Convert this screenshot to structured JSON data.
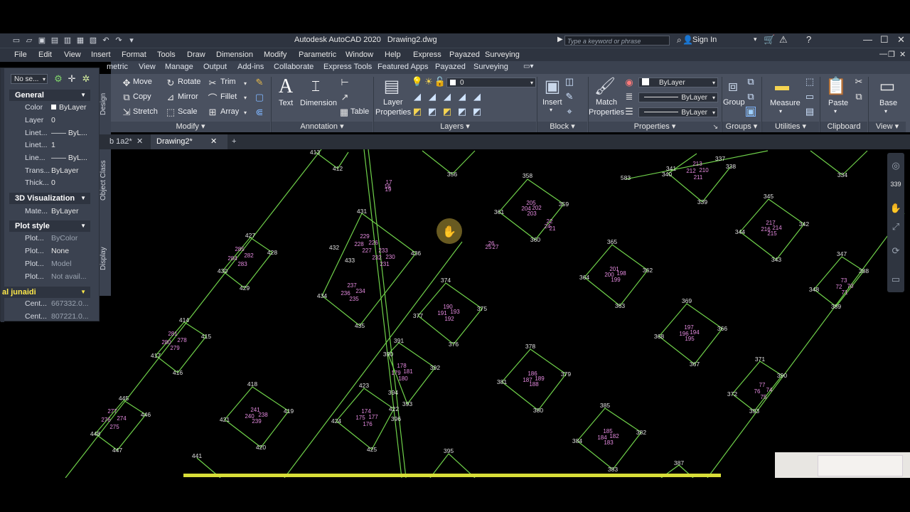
{
  "app": {
    "title": "Autodesk AutoCAD 2020   Drawing2.dwg",
    "search_placeholder": "Type a keyword or phrase",
    "sign_in": "Sign In"
  },
  "menu": [
    "File",
    "Edit",
    "View",
    "Insert",
    "Format",
    "Tools",
    "Draw",
    "Dimension",
    "Modify",
    "Parametric",
    "Window",
    "Help",
    "Express",
    "Payazed",
    "Surveying"
  ],
  "ribbon_tabs": [
    "metric",
    "View",
    "Manage",
    "Output",
    "Add-ins",
    "Collaborate",
    "Express Tools",
    "Featured Apps",
    "Payazed",
    "Surveying"
  ],
  "ribbon": {
    "modify": {
      "title": "Modify",
      "move": "Move",
      "rotate": "Rotate",
      "trim": "Trim",
      "copy": "Copy",
      "mirror": "Mirror",
      "fillet": "Fillet",
      "stretch": "Stretch",
      "scale": "Scale",
      "array": "Array"
    },
    "annotation": {
      "title": "Annotation",
      "text": "Text",
      "dimension": "Dimension",
      "table": "Table"
    },
    "layers": {
      "title": "Layers",
      "layer_properties_1": "Layer",
      "layer_properties_2": "Properties",
      "current_layer": "0"
    },
    "block": {
      "title": "Block",
      "insert": "Insert"
    },
    "properties": {
      "title": "Properties",
      "match_1": "Match",
      "match_2": "Properties",
      "color": "ByLayer",
      "linetype": "ByLayer",
      "lineweight": "ByLayer"
    },
    "groups": {
      "title": "Groups",
      "group": "Group"
    },
    "utilities": {
      "title": "Utilities",
      "measure": "Measure"
    },
    "clipboard": {
      "title": "Clipboard",
      "paste": "Paste"
    },
    "view": {
      "title": "View",
      "base": "Base"
    }
  },
  "doc_tabs": [
    {
      "label": "b 1a2*"
    },
    {
      "label": "Drawing2*"
    }
  ],
  "palette": {
    "selection": "No se...",
    "general_title": "General",
    "general": [
      {
        "k": "Color",
        "v": "ByLayer"
      },
      {
        "k": "Layer",
        "v": "0"
      },
      {
        "k": "Linet...",
        "v": "—— ByL..."
      },
      {
        "k": "Linet...",
        "v": "1"
      },
      {
        "k": "Line...",
        "v": "—— ByL..."
      },
      {
        "k": "Trans...",
        "v": "ByLayer"
      },
      {
        "k": "Thick...",
        "v": "0"
      }
    ],
    "viz_title": "3D Visualization",
    "viz": [
      {
        "k": "Mate...",
        "v": "ByLayer"
      }
    ],
    "plot_title": "Plot style",
    "plot": [
      {
        "k": "Plot...",
        "v": "ByColor"
      },
      {
        "k": "Plot...",
        "v": "None"
      },
      {
        "k": "Plot...",
        "v": "Model"
      },
      {
        "k": "Plot...",
        "v": "Not avail..."
      }
    ],
    "custom_title": "al junaidi",
    "custom": [
      {
        "k": "Cent...",
        "v": "667332.0..."
      },
      {
        "k": "Cent...",
        "v": "807221.0..."
      }
    ],
    "side_tabs": [
      "Design",
      "Object Class",
      "Display"
    ]
  },
  "drawing": {
    "line_color": "#6fd14a",
    "label_color": "#e0e0e0",
    "inner_color": "#e58be0",
    "points": [
      [
        "413",
        443,
        214
      ],
      [
        "412",
        475,
        237
      ],
      [
        "356",
        636,
        245
      ],
      [
        "358",
        742,
        247
      ],
      [
        "583",
        880,
        250
      ],
      [
        "340",
        938,
        245
      ],
      [
        "341",
        944,
        237
      ],
      [
        "337",
        1013,
        223
      ],
      [
        "338",
        1028,
        234
      ],
      [
        "339",
        988,
        284
      ],
      [
        "334",
        1185,
        246
      ],
      [
        "335",
        1260,
        260
      ],
      [
        "431",
        509,
        297
      ],
      [
        "361",
        702,
        298
      ],
      [
        "359",
        793,
        287
      ],
      [
        "345",
        1081,
        276
      ],
      [
        "344",
        1041,
        326
      ],
      [
        "342",
        1131,
        315
      ],
      [
        "343",
        1092,
        365
      ],
      [
        "427",
        352,
        331
      ],
      [
        "428",
        383,
        355
      ],
      [
        "430",
        313,
        381
      ],
      [
        "429",
        344,
        405
      ],
      [
        "432",
        470,
        348
      ],
      [
        "433",
        492,
        366
      ],
      [
        "436",
        585,
        356
      ],
      [
        "360",
        753,
        337
      ],
      [
        "365",
        861,
        340
      ],
      [
        "364",
        822,
        390
      ],
      [
        "362",
        911,
        380
      ],
      [
        "363",
        872,
        430
      ],
      [
        "347",
        1184,
        357
      ],
      [
        "388",
        1215,
        381
      ],
      [
        "348",
        1145,
        407
      ],
      [
        "389",
        1176,
        431
      ],
      [
        "374",
        627,
        394
      ],
      [
        "375",
        678,
        434
      ],
      [
        "377",
        588,
        444
      ],
      [
        "376",
        638,
        484
      ],
      [
        "434",
        453,
        416
      ],
      [
        "435",
        506,
        458
      ],
      [
        "414",
        259,
        450
      ],
      [
        "415",
        290,
        473
      ],
      [
        "417",
        219,
        500
      ],
      [
        "416",
        250,
        524
      ],
      [
        "391",
        561,
        479
      ],
      [
        "390",
        546,
        498
      ],
      [
        "392",
        612,
        517
      ],
      [
        "369",
        966,
        423
      ],
      [
        "366",
        1016,
        462
      ],
      [
        "368",
        927,
        473
      ],
      [
        "367",
        977,
        512
      ],
      [
        "378",
        746,
        487
      ],
      [
        "379",
        796,
        526
      ],
      [
        "381",
        706,
        537
      ],
      [
        "380",
        757,
        577
      ],
      [
        "371",
        1069,
        505
      ],
      [
        "390",
        1100,
        528
      ],
      [
        "372",
        1030,
        554
      ],
      [
        "393",
        1061,
        578
      ],
      [
        "418",
        355,
        540
      ],
      [
        "419",
        406,
        578
      ],
      [
        "421",
        316,
        590
      ],
      [
        "420",
        367,
        629
      ],
      [
        "423",
        512,
        542
      ],
      [
        "422",
        554,
        575
      ],
      [
        "424",
        473,
        592
      ],
      [
        "425",
        523,
        632
      ],
      [
        "394",
        553,
        552
      ],
      [
        "393",
        573,
        568
      ],
      [
        "396",
        557,
        589
      ],
      [
        "445",
        174,
        560
      ],
      [
        "446",
        205,
        583
      ],
      [
        "448",
        134,
        610
      ],
      [
        "447",
        165,
        633
      ],
      [
        "385",
        851,
        570
      ],
      [
        "382",
        902,
        608
      ],
      [
        "384",
        812,
        620
      ],
      [
        "383",
        862,
        660
      ],
      [
        "441",
        277,
        641
      ],
      [
        "395",
        631,
        634
      ],
      [
        "387",
        955,
        651
      ]
    ],
    "inner_labels": [
      [
        "17",
        547,
        256
      ],
      [
        "16",
        545,
        262
      ],
      [
        "19",
        546,
        266
      ],
      [
        "205",
        747,
        285
      ],
      [
        "204",
        740,
        293
      ],
      [
        "202",
        755,
        292
      ],
      [
        "203",
        748,
        300
      ],
      [
        "22",
        773,
        311
      ],
      [
        "24",
        770,
        318
      ],
      [
        "21",
        777,
        321
      ],
      [
        "213",
        981,
        230
      ],
      [
        "212",
        972,
        240
      ],
      [
        "210",
        990,
        239
      ],
      [
        "211",
        982,
        249
      ],
      [
        "217",
        1084,
        313
      ],
      [
        "216",
        1077,
        322
      ],
      [
        "214",
        1093,
        320
      ],
      [
        "215",
        1086,
        328
      ],
      [
        "229",
        513,
        332
      ],
      [
        "228",
        505,
        343
      ],
      [
        "226",
        525,
        341
      ],
      [
        "233",
        539,
        352
      ],
      [
        "227",
        516,
        352
      ],
      [
        "232",
        530,
        362
      ],
      [
        "230",
        549,
        361
      ],
      [
        "231",
        541,
        371
      ],
      [
        "285",
        337,
        350
      ],
      [
        "284",
        327,
        363
      ],
      [
        "282",
        350,
        359
      ],
      [
        "283",
        341,
        371
      ],
      [
        "26",
        691,
        342
      ],
      [
        "25",
        687,
        347
      ],
      [
        "27",
        697,
        347
      ],
      [
        "201",
        864,
        378
      ],
      [
        "200",
        857,
        386
      ],
      [
        "198",
        874,
        384
      ],
      [
        "199",
        866,
        393
      ],
      [
        "73",
        1187,
        394
      ],
      [
        "72",
        1180,
        403
      ],
      [
        "70",
        1196,
        402
      ],
      [
        "71",
        1188,
        411
      ],
      [
        "237",
        495,
        401
      ],
      [
        "236",
        486,
        412
      ],
      [
        "234",
        507,
        409
      ],
      [
        "235",
        498,
        420
      ],
      [
        "190",
        630,
        431
      ],
      [
        "191",
        622,
        440
      ],
      [
        "193",
        640,
        438
      ],
      [
        "192",
        632,
        448
      ],
      [
        "281",
        243,
        469
      ],
      [
        "280",
        234,
        481
      ],
      [
        "278",
        256,
        478
      ],
      [
        "279",
        246,
        489
      ],
      [
        "197",
        969,
        460
      ],
      [
        "196",
        962,
        469
      ],
      [
        "194",
        977,
        467
      ],
      [
        "195",
        970,
        476
      ],
      [
        "178",
        565,
        514
      ],
      [
        "179",
        557,
        524
      ],
      [
        "181",
        574,
        522
      ],
      [
        "180",
        567,
        532
      ],
      [
        "186",
        749,
        525
      ],
      [
        "187",
        742,
        534
      ],
      [
        "189",
        759,
        532
      ],
      [
        "188",
        751,
        540
      ],
      [
        "77",
        1072,
        541
      ],
      [
        "76",
        1065,
        550
      ],
      [
        "74",
        1082,
        548
      ],
      [
        "75",
        1074,
        558
      ],
      [
        "241",
        359,
        576
      ],
      [
        "240",
        351,
        585
      ],
      [
        "238",
        370,
        583
      ],
      [
        "239",
        361,
        592
      ],
      [
        "174",
        515,
        578
      ],
      [
        "175",
        507,
        587
      ],
      [
        "177",
        525,
        586
      ],
      [
        "176",
        517,
        596
      ],
      [
        "277",
        158,
        578
      ],
      [
        "276",
        149,
        590
      ],
      [
        "274",
        171,
        588
      ],
      [
        "275",
        161,
        600
      ],
      [
        "185",
        855,
        606
      ],
      [
        "184",
        847,
        615
      ],
      [
        "182",
        864,
        613
      ],
      [
        "183",
        856,
        622
      ]
    ]
  }
}
